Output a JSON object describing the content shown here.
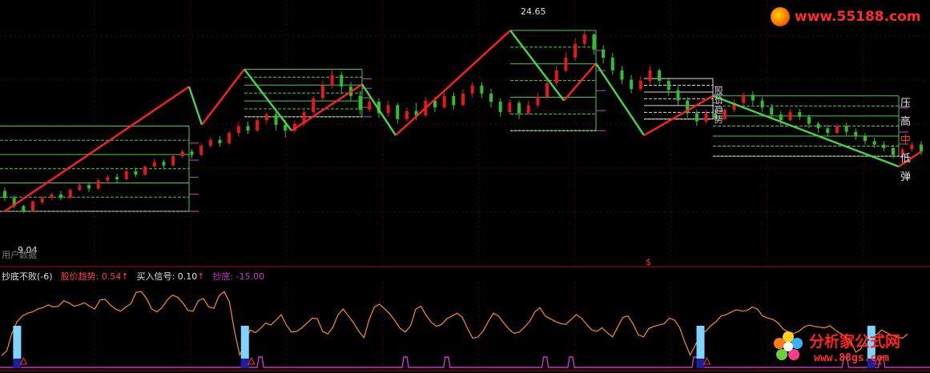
{
  "palette": {
    "grid": "#5a0000",
    "up": "#e31818",
    "down": "#2fbf2f",
    "trend_up": "#ff2020",
    "trend_down": "#46d646",
    "level_green": "#3fcf3f",
    "level_white": "#d9d9d9",
    "level_magenta": "#c04ad0",
    "osc": "#ff8c1a",
    "signal": "#cc33cc",
    "bar_light": "#7fd4ff",
    "bar_dark": "#1e1e9e",
    "text": "#e0e0e0",
    "red_text": "#ff4040"
  },
  "upper": {
    "price_range": [
      6,
      27
    ],
    "labels": {
      "high": "24.65",
      "low": "9.04"
    },
    "bottom_text": "用户数据",
    "dollar_marker": "$",
    "vertical_note": "股价趋势",
    "side_labels": [
      "压",
      "高",
      "中",
      "低",
      "弹"
    ],
    "candles": [
      [
        10.8,
        10.2,
        11.1,
        9.9
      ],
      [
        10.2,
        9.5,
        10.4,
        9.3
      ],
      [
        9.5,
        9.1,
        9.6,
        8.9
      ],
      [
        9.1,
        9.9,
        10.0,
        9.0
      ],
      [
        9.8,
        10.2,
        10.4,
        9.6
      ],
      [
        10.2,
        10.5,
        10.6,
        10.0
      ],
      [
        10.5,
        10.2,
        10.8,
        10.0
      ],
      [
        10.2,
        10.9,
        11.0,
        10.1
      ],
      [
        10.9,
        11.3,
        11.5,
        10.8
      ],
      [
        11.3,
        11.0,
        11.5,
        10.7
      ],
      [
        11.0,
        11.7,
        11.9,
        10.9
      ],
      [
        11.7,
        12.0,
        12.2,
        11.4
      ],
      [
        12.0,
        11.8,
        12.3,
        11.5
      ],
      [
        11.8,
        12.5,
        12.7,
        11.7
      ],
      [
        12.5,
        12.2,
        12.8,
        12.0
      ],
      [
        12.2,
        12.9,
        13.0,
        12.1
      ],
      [
        12.9,
        13.3,
        13.6,
        12.8
      ],
      [
        13.3,
        13.0,
        13.5,
        12.7
      ],
      [
        13.0,
        13.8,
        14.0,
        12.9
      ],
      [
        13.8,
        14.2,
        14.4,
        13.6
      ],
      [
        14.2,
        13.9,
        14.4,
        13.6
      ],
      [
        13.9,
        14.7,
        14.9,
        13.8
      ],
      [
        14.7,
        15.2,
        15.4,
        14.5
      ],
      [
        15.2,
        14.9,
        15.5,
        14.6
      ],
      [
        14.9,
        15.8,
        16.0,
        14.8
      ],
      [
        15.8,
        16.4,
        16.8,
        15.5
      ],
      [
        16.4,
        16.0,
        16.8,
        15.7
      ],
      [
        16.0,
        16.9,
        17.2,
        15.9
      ],
      [
        16.9,
        17.4,
        17.6,
        16.6
      ],
      [
        17.4,
        16.5,
        17.6,
        16.0
      ],
      [
        16.5,
        16.0,
        16.9,
        15.4
      ],
      [
        16.0,
        16.6,
        16.9,
        15.8
      ],
      [
        16.6,
        17.6,
        17.8,
        16.4
      ],
      [
        17.6,
        18.8,
        19.0,
        17.4
      ],
      [
        18.8,
        19.9,
        20.3,
        18.6
      ],
      [
        19.9,
        20.8,
        21.3,
        19.6
      ],
      [
        20.8,
        19.8,
        21.1,
        19.2
      ],
      [
        19.8,
        19.0,
        20.2,
        18.6
      ],
      [
        19.0,
        17.8,
        19.4,
        17.4
      ],
      [
        17.8,
        18.5,
        18.9,
        17.6
      ],
      [
        18.5,
        17.5,
        18.8,
        17.1
      ],
      [
        17.5,
        18.2,
        18.6,
        17.2
      ],
      [
        18.2,
        17.0,
        18.4,
        16.6
      ],
      [
        17.0,
        17.7,
        18.0,
        16.8
      ],
      [
        17.7,
        17.3,
        18.4,
        16.9
      ],
      [
        17.3,
        18.6,
        18.9,
        17.2
      ],
      [
        18.6,
        18.0,
        18.9,
        17.6
      ],
      [
        18.0,
        19.0,
        19.4,
        17.9
      ],
      [
        19.0,
        18.2,
        19.3,
        17.8
      ],
      [
        18.2,
        19.2,
        19.6,
        18.1
      ],
      [
        19.2,
        19.9,
        20.2,
        18.9
      ],
      [
        19.9,
        19.2,
        20.2,
        18.8
      ],
      [
        19.2,
        18.5,
        19.6,
        18.0
      ],
      [
        18.5,
        17.6,
        18.8,
        17.2
      ],
      [
        17.6,
        18.4,
        18.7,
        17.4
      ],
      [
        18.4,
        17.5,
        18.6,
        17.0
      ],
      [
        17.5,
        18.2,
        18.6,
        17.3
      ],
      [
        18.2,
        18.9,
        19.3,
        18.0
      ],
      [
        18.9,
        20.1,
        20.5,
        18.7
      ],
      [
        20.1,
        21.2,
        21.6,
        19.9
      ],
      [
        21.2,
        22.3,
        22.8,
        21.0
      ],
      [
        22.3,
        23.5,
        24.0,
        22.0
      ],
      [
        23.5,
        24.3,
        24.65,
        23.2
      ],
      [
        24.3,
        23.0,
        24.4,
        22.6
      ],
      [
        23.0,
        22.3,
        23.4,
        21.8
      ],
      [
        22.3,
        21.2,
        22.7,
        20.8
      ],
      [
        21.2,
        20.4,
        21.6,
        20.0
      ],
      [
        20.4,
        19.6,
        20.8,
        19.2
      ],
      [
        19.6,
        20.3,
        20.7,
        19.4
      ],
      [
        20.3,
        21.2,
        21.6,
        20.0
      ],
      [
        21.2,
        20.3,
        21.4,
        19.8
      ],
      [
        20.3,
        19.5,
        20.6,
        19.0
      ],
      [
        19.5,
        18.6,
        19.8,
        18.2
      ],
      [
        18.6,
        17.5,
        18.9,
        17.1
      ],
      [
        17.5,
        16.8,
        17.8,
        16.4
      ],
      [
        16.8,
        17.5,
        17.8,
        16.6
      ],
      [
        17.5,
        17.0,
        17.9,
        16.7
      ],
      [
        17.0,
        17.8,
        18.0,
        16.9
      ],
      [
        17.8,
        18.4,
        18.7,
        17.6
      ],
      [
        18.4,
        19.1,
        19.3,
        18.1
      ],
      [
        19.1,
        18.6,
        19.4,
        18.2
      ],
      [
        18.6,
        18.0,
        18.9,
        17.6
      ],
      [
        18.0,
        17.4,
        18.3,
        17.0
      ],
      [
        17.4,
        16.9,
        17.7,
        16.5
      ],
      [
        16.9,
        17.6,
        17.9,
        16.8
      ],
      [
        17.6,
        17.2,
        17.9,
        16.9
      ],
      [
        17.2,
        16.6,
        17.4,
        16.2
      ],
      [
        16.6,
        16.2,
        16.8,
        15.8
      ],
      [
        16.2,
        15.8,
        16.5,
        15.5
      ],
      [
        15.8,
        16.4,
        16.6,
        15.7
      ],
      [
        16.4,
        15.9,
        16.7,
        15.6
      ],
      [
        15.9,
        15.5,
        16.2,
        15.2
      ],
      [
        15.5,
        15.1,
        15.8,
        14.8
      ],
      [
        15.1,
        14.8,
        15.4,
        14.5
      ],
      [
        14.8,
        14.5,
        15.1,
        14.2
      ],
      [
        14.5,
        13.9,
        14.8,
        13.6
      ],
      [
        13.9,
        14.4,
        14.6,
        13.7
      ],
      [
        14.4,
        14.8,
        15.0,
        14.2
      ],
      [
        14.8,
        14.2,
        15.1,
        13.9
      ]
    ],
    "zigzag": [
      [
        9.04,
        true
      ],
      [
        19.8,
        false
      ],
      [
        16.5,
        true
      ],
      [
        21.3,
        false
      ],
      [
        16.0,
        true
      ],
      [
        20.0,
        false
      ],
      [
        15.6,
        true
      ],
      [
        24.65,
        false
      ],
      [
        18.6,
        true
      ],
      [
        21.8,
        false
      ],
      [
        15.6,
        true
      ],
      [
        19.0,
        false
      ],
      [
        12.9,
        true
      ],
      [
        14.2,
        false
      ]
    ],
    "level_sets": [
      {
        "top": 16.4,
        "bottom": 9.04,
        "color": "level_green"
      },
      {
        "top": 21.3,
        "bottom": 17.2,
        "color": "level_green"
      },
      {
        "top": 24.65,
        "bottom": 16.0,
        "color": "level_green"
      },
      {
        "top": 20.5,
        "bottom": 17.0,
        "color": "level_white"
      },
      {
        "top": 19.0,
        "bottom": 13.8,
        "color": "level_green"
      }
    ]
  },
  "lower": {
    "indicator_name": "抄底不败(-6)",
    "readouts": [
      {
        "label": "股价趋势:",
        "value": "0.54",
        "arrow": "↑",
        "color": "#ff4040"
      },
      {
        "label": "买入信号:",
        "value": "0.10",
        "arrow": "↑",
        "color": "#e0e0e0"
      },
      {
        "label": "抄底:",
        "value": "-15.00",
        "arrow": "",
        "color": "#cc33cc"
      }
    ],
    "osc_range": [
      -15,
      100
    ],
    "oscillator": [
      3,
      10,
      35,
      52,
      60,
      64,
      66,
      70,
      72,
      76,
      73,
      74,
      82,
      79,
      74,
      76,
      79,
      74,
      70,
      83,
      84,
      76,
      70,
      67,
      73,
      78,
      94,
      95,
      85,
      70,
      66,
      72,
      83,
      90,
      87,
      79,
      68,
      67,
      82,
      85,
      73,
      71,
      89,
      95,
      80,
      38,
      4,
      20,
      40,
      36,
      42,
      50,
      47,
      54,
      62,
      47,
      37,
      38,
      43,
      50,
      57,
      56,
      38,
      34,
      44,
      62,
      70,
      60,
      50,
      38,
      29,
      55,
      73,
      77,
      70,
      63,
      53,
      42,
      37,
      46,
      70,
      74,
      61,
      51,
      45,
      48,
      56,
      60,
      64,
      58,
      42,
      28,
      30,
      38,
      52,
      64,
      60,
      50,
      41,
      35,
      37,
      44,
      52,
      66,
      72,
      60,
      56,
      52,
      49,
      48,
      55,
      62,
      57,
      48,
      40,
      38,
      43,
      36,
      30,
      44,
      58,
      60,
      48,
      33,
      30,
      42,
      45,
      47,
      49,
      57,
      54,
      43,
      22,
      4,
      18,
      34,
      38,
      46,
      52,
      60,
      62,
      66,
      69,
      67,
      68,
      73,
      70,
      60,
      57,
      55,
      50,
      41,
      37,
      35,
      38,
      44,
      47,
      45,
      44,
      43,
      46,
      40,
      35,
      30,
      24,
      8,
      13,
      27,
      35,
      33,
      40,
      36,
      32,
      30,
      28,
      34
    ],
    "buy_marks": [
      3,
      47,
      135,
      168
    ],
    "signal_peaks": [
      47,
      50,
      78,
      86,
      105,
      110,
      134,
      163,
      170
    ]
  },
  "watermarks": {
    "top_right": "www.55188.com",
    "bottom_right_1": "分析家公式网",
    "bottom_right_2": "www.88gs.com"
  }
}
